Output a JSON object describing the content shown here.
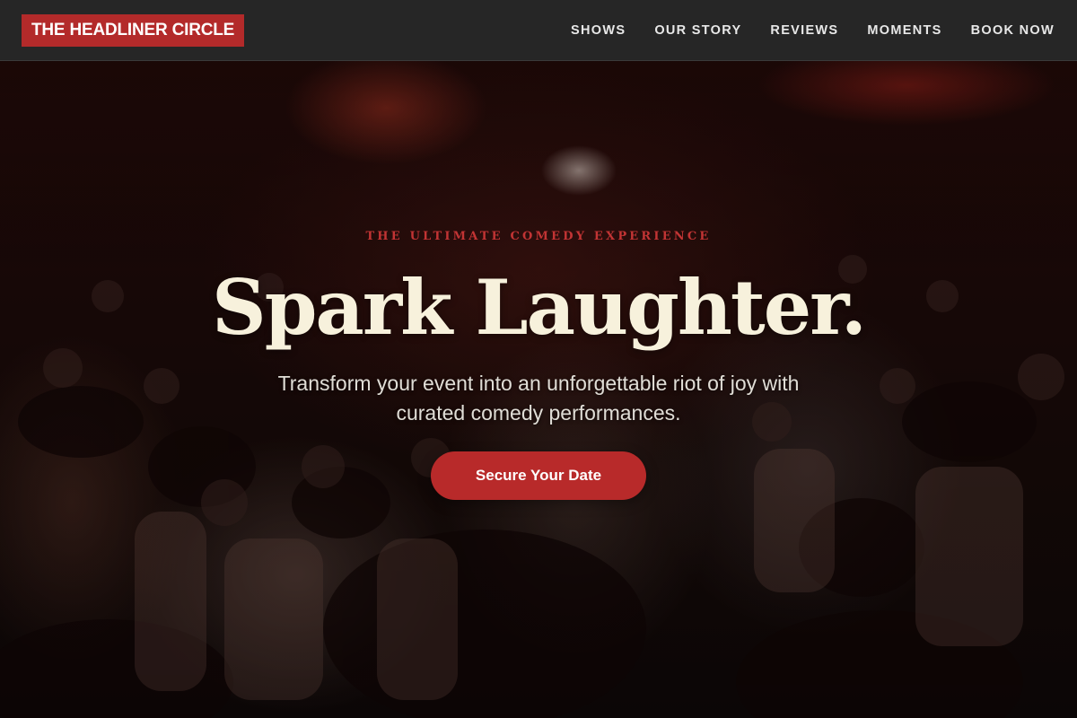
{
  "brand": {
    "name": "THE HEADLINER CIRCLE"
  },
  "nav": {
    "items": [
      {
        "label": "SHOWS"
      },
      {
        "label": "OUR STORY"
      },
      {
        "label": "REVIEWS"
      },
      {
        "label": "MOMENTS"
      },
      {
        "label": "BOOK NOW"
      }
    ]
  },
  "hero": {
    "eyebrow": "THE ULTIMATE COMEDY EXPERIENCE",
    "headline": "Spark Laughter.",
    "subhead": "Transform your event into an unforgettable riot of joy with curated comedy performances.",
    "cta_label": "Secure Your Date"
  },
  "colors": {
    "accent": "#b82a2a",
    "nav_background": "#262626",
    "headline": "#f7f1dc",
    "eyebrow": "#c23434"
  }
}
